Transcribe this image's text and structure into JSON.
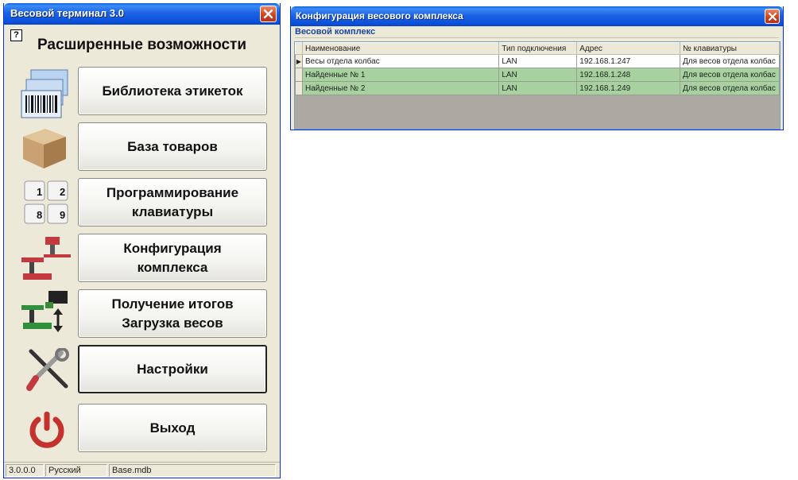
{
  "left_window": {
    "title": "Весовой терминал 3.0",
    "help_label": "?",
    "heading": "Расширенные возможности",
    "buttons": {
      "labels_library": "Библиотека этикеток",
      "goods_base": "База товаров",
      "keyboard_programming_line1": "Программирование",
      "keyboard_programming_line2": "клавиатуры",
      "complex_config_line1": "Конфигурация",
      "complex_config_line2": "комплекса",
      "totals_line1": "Получение итогов",
      "totals_line2": "Загрузка весов",
      "settings": "Настройки",
      "exit": "Выход"
    },
    "keypad_digits": [
      "1",
      "2",
      "8",
      "9"
    ],
    "status_bar": {
      "version": "3.0.0.0",
      "language": "Русский",
      "database": "Base.mdb"
    }
  },
  "right_window": {
    "title": "Конфигурация весового комплекса",
    "group_label": "Весовой комплекс",
    "columns": [
      "Наименование",
      "Тип подключения",
      "Адрес",
      "№ клавиатуры"
    ],
    "rows": [
      {
        "name": "Весы отдела колбас",
        "connection": "LAN",
        "address": "192.168.1.247",
        "keyboard": "Для весов отдела колбас"
      },
      {
        "name": "Найденные № 1",
        "connection": "LAN",
        "address": "192.168.1.248",
        "keyboard": "Для весов отдела колбас"
      },
      {
        "name": "Найденные № 2",
        "connection": "LAN",
        "address": "192.168.1.249",
        "keyboard": "Для весов отдела колбас"
      }
    ],
    "row_indicator": "▶"
  },
  "colors": {
    "titlebar": "#0a4fd8",
    "found_row": "#a7d2a0",
    "close_button": "#d0431f"
  }
}
